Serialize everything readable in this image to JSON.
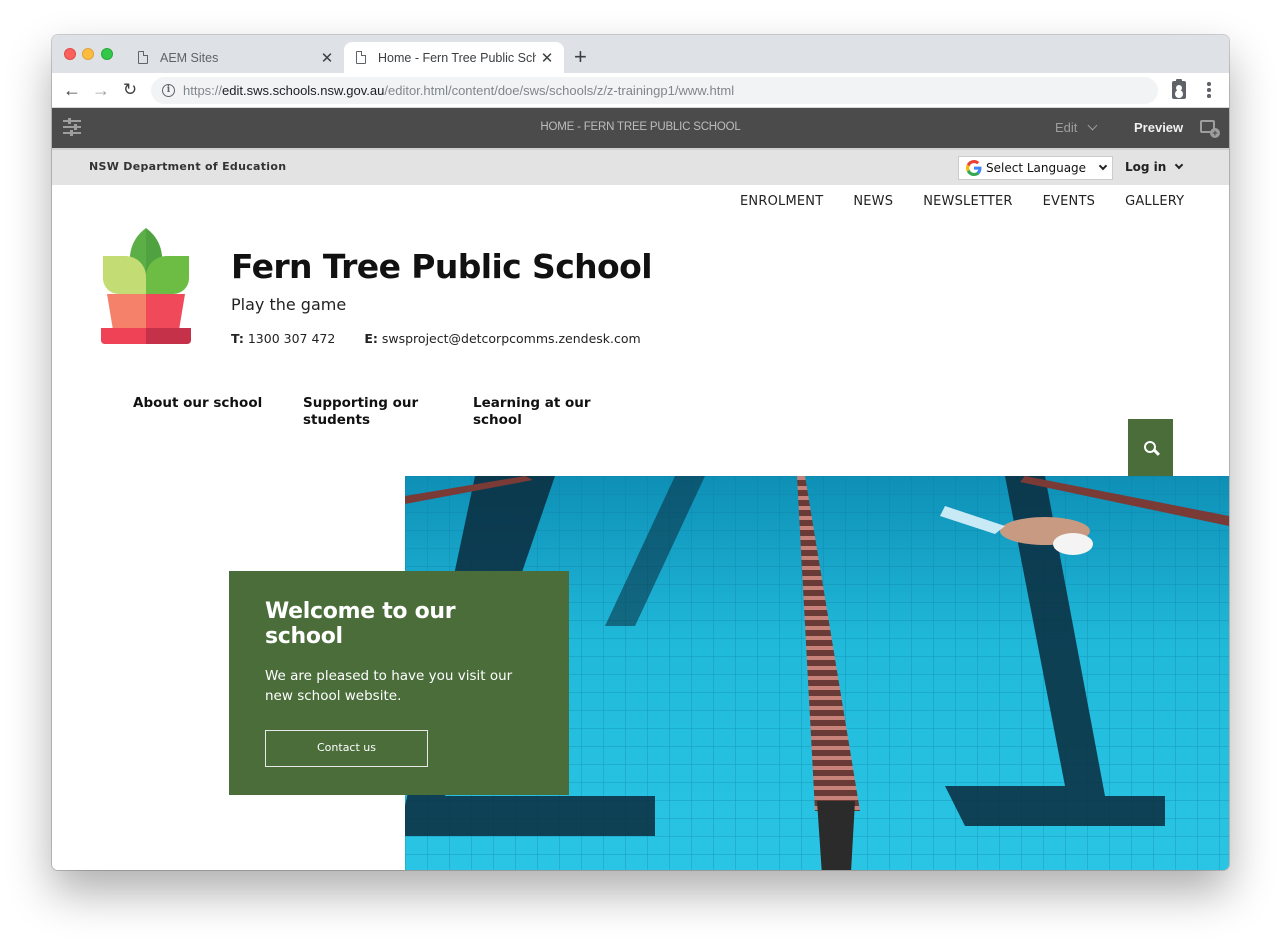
{
  "browser": {
    "tabs": [
      {
        "title": "AEM Sites",
        "active": false
      },
      {
        "title": "Home - Fern Tree Public School",
        "active": true
      }
    ],
    "url": {
      "scheme": "https://",
      "host": "edit.sws.schools.nsw.gov.au",
      "path": "/editor.html/content/doe/sws/schools/z/z-trainingp1/www.html"
    },
    "nav": {
      "back": "←",
      "forward": "→",
      "reload": "↻"
    },
    "close_glyph": "✕",
    "new_tab_glyph": "+"
  },
  "aem": {
    "page_title": "HOME - FERN TREE PUBLIC SCHOOL",
    "mode_label": "Edit",
    "preview_label": "Preview"
  },
  "utility": {
    "department": "NSW Department of Education",
    "language_label": "Select Language",
    "login_label": "Log in"
  },
  "top_links": [
    "ENROLMENT",
    "NEWS",
    "NEWSLETTER",
    "EVENTS",
    "GALLERY"
  ],
  "school": {
    "name": "Fern Tree Public School",
    "tagline": "Play the game",
    "phone_label": "T:",
    "phone": "1300 307 472",
    "email_label": "E:",
    "email": "swsproject@detcorpcomms.zendesk.com"
  },
  "main_nav": [
    "About our school",
    "Supporting our students",
    "Learning at our school"
  ],
  "hero": {
    "image_alt": "Swimming pool with lane rope and swimmer",
    "heading": "Welcome to our school",
    "body": "We are pleased to have you visit our new school website.",
    "cta_label": "Contact us"
  },
  "colors": {
    "brand_green": "#4a6d3a",
    "aem_bar": "#4b4b4b",
    "utility_bar": "#e3e3e3"
  }
}
